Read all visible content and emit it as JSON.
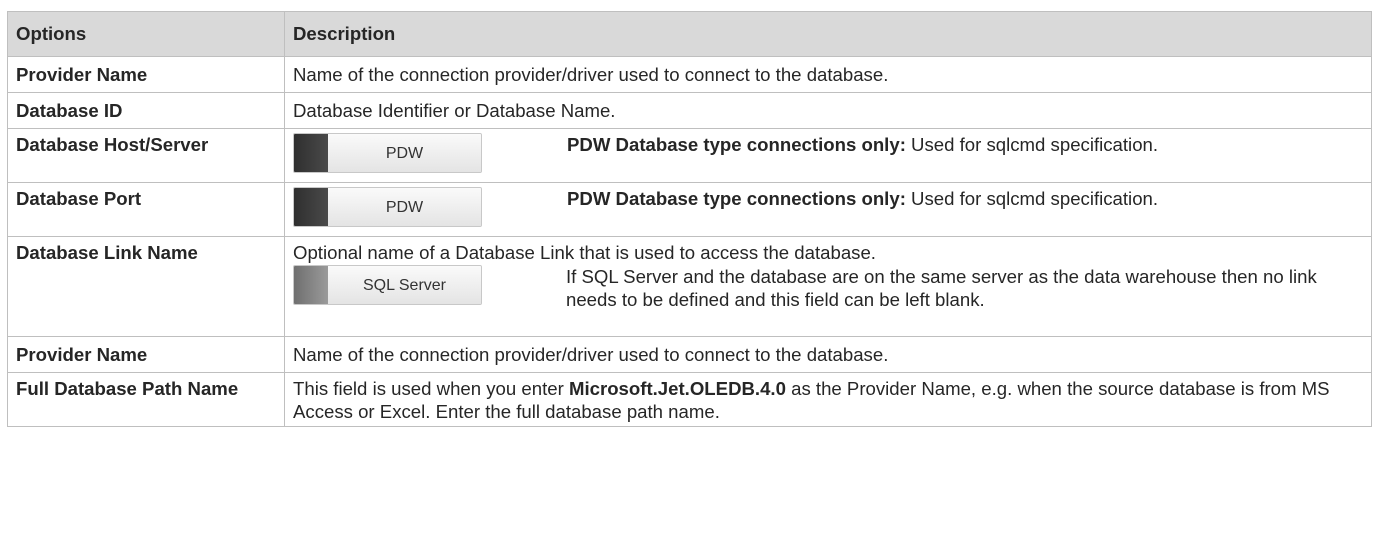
{
  "header": {
    "col_options": "Options",
    "col_description": "Description"
  },
  "rows": [
    {
      "option": "Provider Name",
      "description": "Name of the connection provider/driver used to connect to the database."
    },
    {
      "option": "Database ID",
      "description": "Database Identifier or Database Name."
    },
    {
      "option": "Database Host/Server",
      "badge": "PDW",
      "bold_lead": "PDW Database type connections only:",
      "description": " Used for sqlcmd specification."
    },
    {
      "option": "Database Port",
      "badge": "PDW",
      "bold_lead": "PDW Database type connections only:",
      "description": " Used for sqlcmd specification."
    },
    {
      "option": "Database Link Name",
      "intro": "Optional name of a Database Link that is used to access the database.",
      "badge": "SQL Server",
      "description": "If SQL Server and the database are on the same server as the data warehouse then no link needs to be defined and this field can be left blank."
    },
    {
      "option": "Provider Name",
      "description": "Name of the connection provider/driver used to connect to the database."
    },
    {
      "option": "Full Database Path Name",
      "desc_pre": "This field is used when you enter ",
      "desc_bold": "Microsoft.Jet.OLEDB.4.0",
      "desc_post": " as the Provider Name, e.g. when the source database is from MS Access or Excel. Enter the full database path name."
    }
  ],
  "colors": {
    "header_bg": "#d9d9d9",
    "border": "#bfbfbf",
    "text": "#262626"
  }
}
